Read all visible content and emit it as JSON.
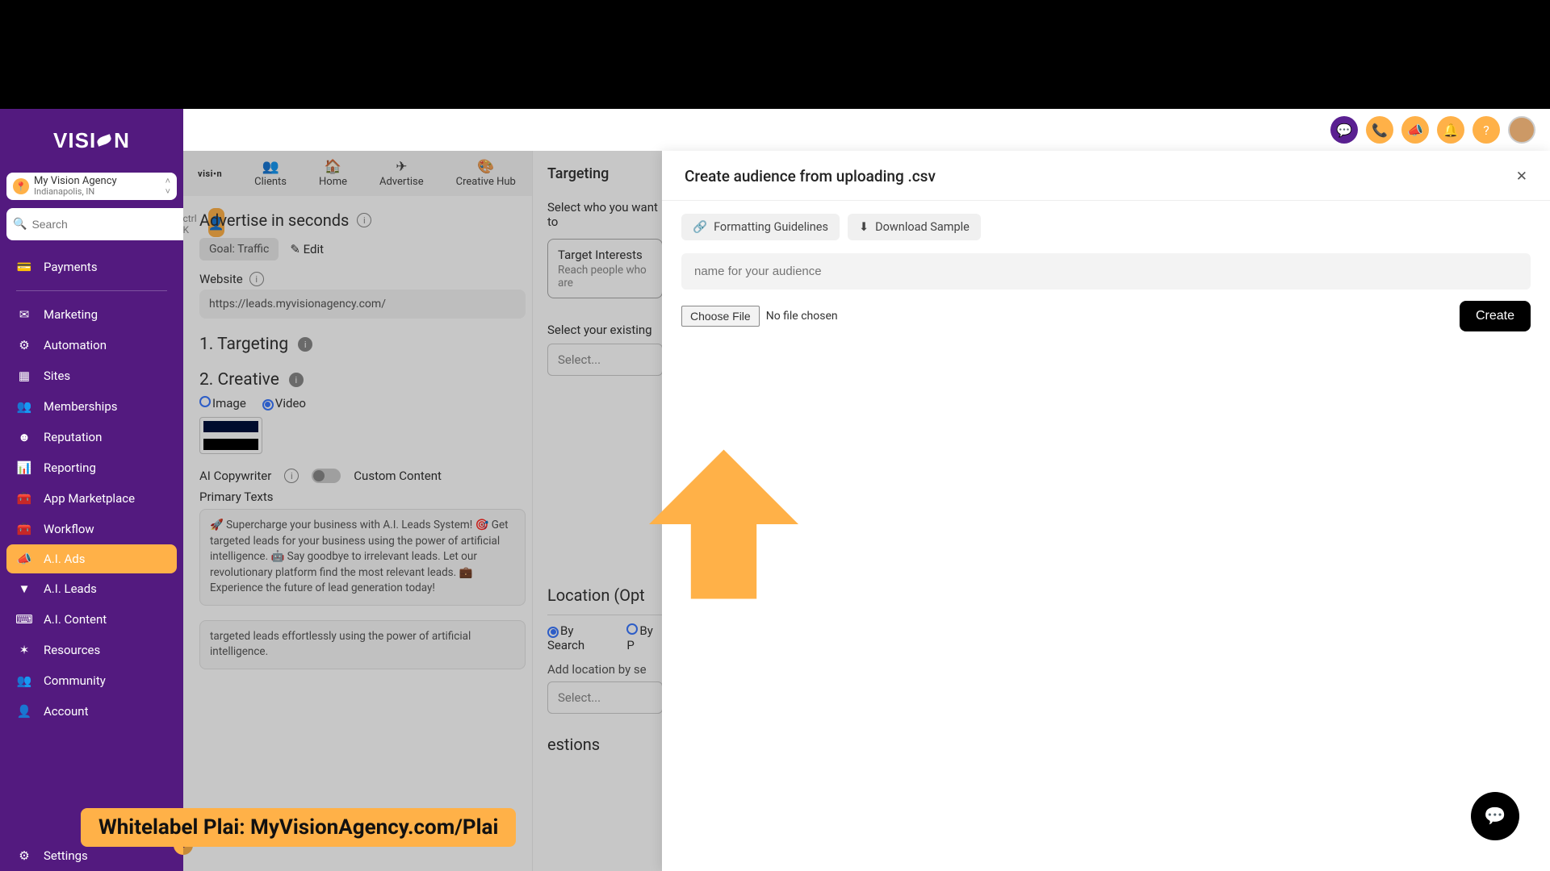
{
  "brand": {
    "logo_text_pre": "VISI",
    "logo_text_post": "N"
  },
  "agency": {
    "name": "My Vision Agency",
    "location": "Indianapolis, IN"
  },
  "search": {
    "placeholder": "Search",
    "shortcut": "ctrl K"
  },
  "sidebar": {
    "items": [
      {
        "label": "Payments",
        "icon": "📊"
      },
      {
        "label": "Marketing",
        "icon": "✉"
      },
      {
        "label": "Automation",
        "icon": "⚙"
      },
      {
        "label": "Sites",
        "icon": "▦"
      },
      {
        "label": "Memberships",
        "icon": "👥"
      },
      {
        "label": "Reputation",
        "icon": "☻"
      },
      {
        "label": "Reporting",
        "icon": "📈"
      },
      {
        "label": "App Marketplace",
        "icon": "🧰"
      },
      {
        "label": "Workflow",
        "icon": "🧰"
      },
      {
        "label": "A.I. Ads",
        "icon": "📣",
        "active": true
      },
      {
        "label": "A.I. Leads",
        "icon": "▼"
      },
      {
        "label": "A.I. Content",
        "icon": "⌨"
      },
      {
        "label": "Resources",
        "icon": "✶"
      },
      {
        "label": "Community",
        "icon": "👥"
      },
      {
        "label": "Account",
        "icon": "👤"
      }
    ],
    "settings_label": "Settings"
  },
  "subtabs": {
    "brand": "visi•n",
    "tabs": [
      {
        "label": "Clients",
        "icon": "👥"
      },
      {
        "label": "Home",
        "icon": "🏠"
      },
      {
        "label": "Advertise",
        "icon": "✈"
      },
      {
        "label": "Creative Hub",
        "icon": "🎨"
      }
    ]
  },
  "advertise": {
    "title": "Advertise in seconds",
    "goal_label": "Goal: Traffic",
    "edit_label": "Edit",
    "website_label": "Website",
    "website_value": "https://leads.myvisionagency.com/",
    "step1": "1.  Targeting",
    "step2": "2. Creative",
    "media_image": "Image",
    "media_video": "Video",
    "ai_copy_label": "AI Copywriter",
    "custom_content_label": "Custom Content",
    "primary_label": "Primary Texts",
    "primary_body": "🚀 Supercharge your business with A.I. Leads System! 🎯 Get targeted leads for your business using the power of artificial intelligence. 🤖 Say goodbye to irrelevant leads. Let our revolutionary platform find the most relevant leads. 💼 Experience the future of lead generation today!",
    "primary_body2": "targeted leads effortlessly using the power of artificial intelligence."
  },
  "targeting": {
    "panel_title": "Targeting",
    "question": "Select who you want to",
    "card_title": "Target Interests",
    "card_sub": "Reach people who are",
    "existing_label": "Select your existing",
    "select_placeholder": "Select...",
    "location_title": "Location (Opt",
    "by_search": "By Search",
    "by_pin": "By P",
    "add_location": "Add location by se",
    "suggestions_title": "estions"
  },
  "modal": {
    "title": "Create audience from uploading .csv",
    "formatting_label": "Formatting Guidelines",
    "download_label": "Download Sample",
    "name_placeholder": "name for your audience",
    "choose_file": "Choose File",
    "no_file": "No file chosen",
    "create_label": "Create"
  },
  "banner": "Whitelabel Plai: MyVisionAgency.com/Plai"
}
